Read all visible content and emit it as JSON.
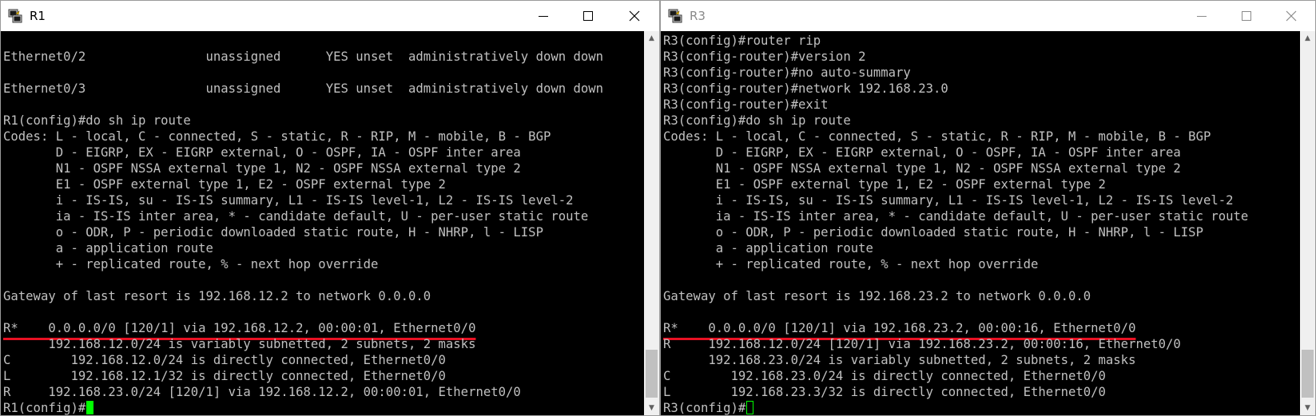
{
  "windows": [
    {
      "id": "r1",
      "title": "R1",
      "active": true,
      "cursor_style": "solid",
      "lines": [
        "",
        "Ethernet0/2                unassigned      YES unset  administratively down down",
        "",
        "Ethernet0/3                unassigned      YES unset  administratively down down",
        "",
        "R1(config)#do sh ip route",
        "Codes: L - local, C - connected, S - static, R - RIP, M - mobile, B - BGP",
        "       D - EIGRP, EX - EIGRP external, O - OSPF, IA - OSPF inter area",
        "       N1 - OSPF NSSA external type 1, N2 - OSPF NSSA external type 2",
        "       E1 - OSPF external type 1, E2 - OSPF external type 2",
        "       i - IS-IS, su - IS-IS summary, L1 - IS-IS level-1, L2 - IS-IS level-2",
        "       ia - IS-IS inter area, * - candidate default, U - per-user static route",
        "       o - ODR, P - periodic downloaded static route, H - NHRP, l - LISP",
        "       a - application route",
        "       + - replicated route, % - next hop override",
        "",
        "Gateway of last resort is 192.168.12.2 to network 0.0.0.0",
        "",
        "R*    0.0.0.0/0 [120/1] via 192.168.12.2, 00:00:01, Ethernet0/0",
        "      192.168.12.0/24 is variably subnetted, 2 subnets, 2 masks",
        "C        192.168.12.0/24 is directly connected, Ethernet0/0",
        "L        192.168.12.1/32 is directly connected, Ethernet0/0",
        "R     192.168.23.0/24 [120/1] via 192.168.12.2, 00:00:01, Ethernet0/0",
        "R1(config)#"
      ],
      "underlined_line": 18
    },
    {
      "id": "r3",
      "title": "R3",
      "active": false,
      "cursor_style": "hollow",
      "lines": [
        "R3(config)#router rip",
        "R3(config-router)#version 2",
        "R3(config-router)#no auto-summary",
        "R3(config-router)#network 192.168.23.0",
        "R3(config-router)#exit",
        "R3(config)#do sh ip route",
        "Codes: L - local, C - connected, S - static, R - RIP, M - mobile, B - BGP",
        "       D - EIGRP, EX - EIGRP external, O - OSPF, IA - OSPF inter area",
        "       N1 - OSPF NSSA external type 1, N2 - OSPF NSSA external type 2",
        "       E1 - OSPF external type 1, E2 - OSPF external type 2",
        "       i - IS-IS, su - IS-IS summary, L1 - IS-IS level-1, L2 - IS-IS level-2",
        "       ia - IS-IS inter area, * - candidate default, U - per-user static route",
        "       o - ODR, P - periodic downloaded static route, H - NHRP, l - LISP",
        "       a - application route",
        "       + - replicated route, % - next hop override",
        "",
        "Gateway of last resort is 192.168.23.2 to network 0.0.0.0",
        "",
        "R*    0.0.0.0/0 [120/1] via 192.168.23.2, 00:00:16, Ethernet0/0",
        "R     192.168.12.0/24 [120/1] via 192.168.23.2, 00:00:16, Ethernet0/0",
        "      192.168.23.0/24 is variably subnetted, 2 subnets, 2 masks",
        "C        192.168.23.0/24 is directly connected, Ethernet0/0",
        "L        192.168.23.3/32 is directly connected, Ethernet0/0",
        "R3(config)#"
      ],
      "underlined_line": 18
    }
  ],
  "icons": {
    "app": "putty-terminal-icon",
    "minimize": "minimize-icon",
    "maximize": "maximize-icon",
    "close": "close-icon"
  },
  "colors": {
    "terminal_bg": "#000000",
    "terminal_text": "#c0c0c0",
    "cursor": "#00ff00",
    "highlight_underline": "#e81123"
  }
}
